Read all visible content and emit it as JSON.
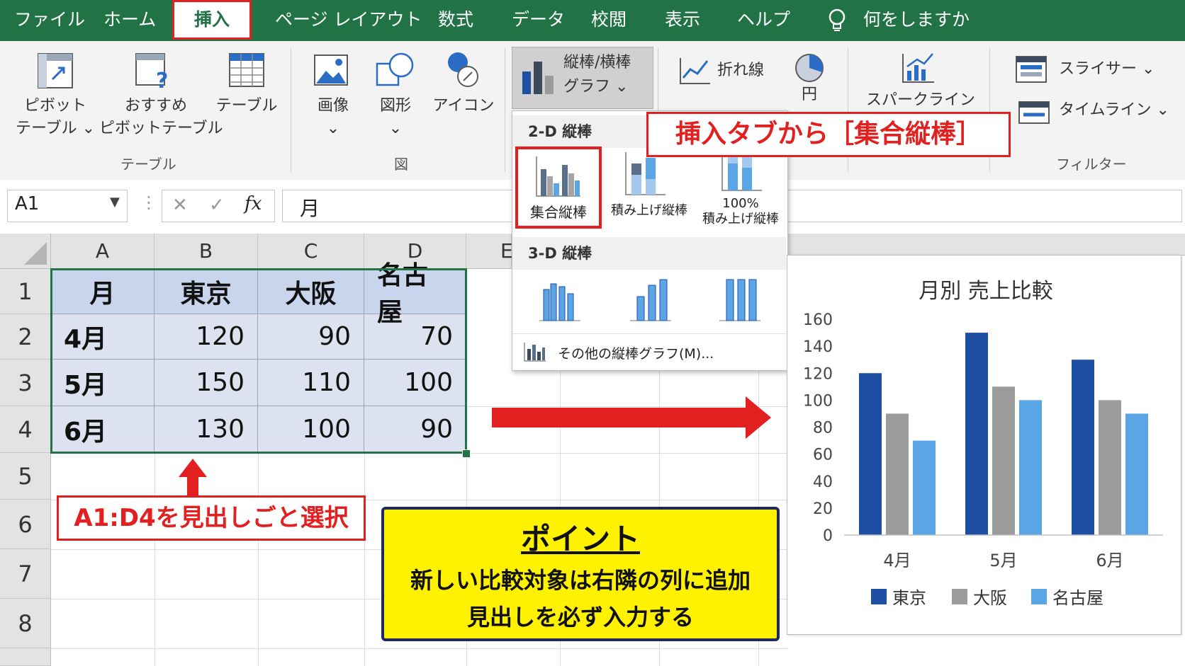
{
  "menubar": {
    "items": [
      "ファイル",
      "ホーム",
      "挿入",
      "ページ レイアウト",
      "数式",
      "データ",
      "校閲",
      "表示",
      "ヘルプ"
    ],
    "tell_me": "何をしますか",
    "active_tab": "挿入"
  },
  "ribbon": {
    "pivot_table": [
      "ピボット",
      "テーブル ⌄"
    ],
    "recommended_pivot": [
      "おすすめ",
      "ピボットテーブル"
    ],
    "table": "テーブル",
    "group_table": "テーブル",
    "image": "画像",
    "shapes": "図形",
    "icons": "アイコン",
    "group_figure": "図",
    "chart_button": [
      "縦棒/横棒",
      "グラフ ⌄"
    ],
    "line_chart": "折れ線",
    "pie_chart": "円",
    "sparkline": "スパークライン",
    "slicer": "スライサー ⌄",
    "timeline": "タイムライン ⌄",
    "group_filter": "フィルター"
  },
  "formula_bar": {
    "name_box": "A1",
    "cancel": "✕",
    "enter": "✓",
    "fx": "fx",
    "value": "月"
  },
  "sheet": {
    "columns": [
      "A",
      "B",
      "C",
      "D",
      "E"
    ],
    "rows": [
      "1",
      "2",
      "3",
      "4",
      "5",
      "6",
      "7",
      "8"
    ],
    "table": [
      [
        "月",
        "東京",
        "大阪",
        "名古屋"
      ],
      [
        "4月",
        "120",
        "90",
        "70"
      ],
      [
        "5月",
        "150",
        "110",
        "100"
      ],
      [
        "6月",
        "130",
        "100",
        "90"
      ]
    ]
  },
  "dropdown": {
    "section_2d": "2-D 縦棒",
    "clustered": "集合縦棒",
    "stacked": "積み上げ縦棒",
    "stacked100": [
      "100%",
      "積み上げ縦棒"
    ],
    "section_3d": "3-D 縦棒",
    "more": "その他の縦棒グラフ(M)..."
  },
  "callouts": {
    "insert_tab": "挿入タブから［集合縦棒］",
    "select_range": "A1:D4を見出しごと選択",
    "point_title": "ポイント",
    "point_lines": [
      "新しい比較対象は右隣の列に追加",
      "見出しを必ず入力する"
    ]
  },
  "colors": {
    "excel_green": "#217346",
    "callout_red": "#e32020",
    "tokyo": "#1f4fa3",
    "osaka": "#9b9b9b",
    "nagoya": "#5aa5e6",
    "point_yellow": "#fff200"
  },
  "chart_data": {
    "type": "bar",
    "title": "月別 売上比較",
    "categories": [
      "4月",
      "5月",
      "6月"
    ],
    "series": [
      {
        "name": "東京",
        "values": [
          120,
          150,
          130
        ]
      },
      {
        "name": "大阪",
        "values": [
          90,
          110,
          100
        ]
      },
      {
        "name": "名古屋",
        "values": [
          70,
          100,
          90
        ]
      }
    ],
    "ylim": [
      0,
      160
    ],
    "yticks": [
      0,
      20,
      40,
      60,
      80,
      100,
      120,
      140,
      160
    ],
    "grid": false,
    "legend": "bottom"
  }
}
